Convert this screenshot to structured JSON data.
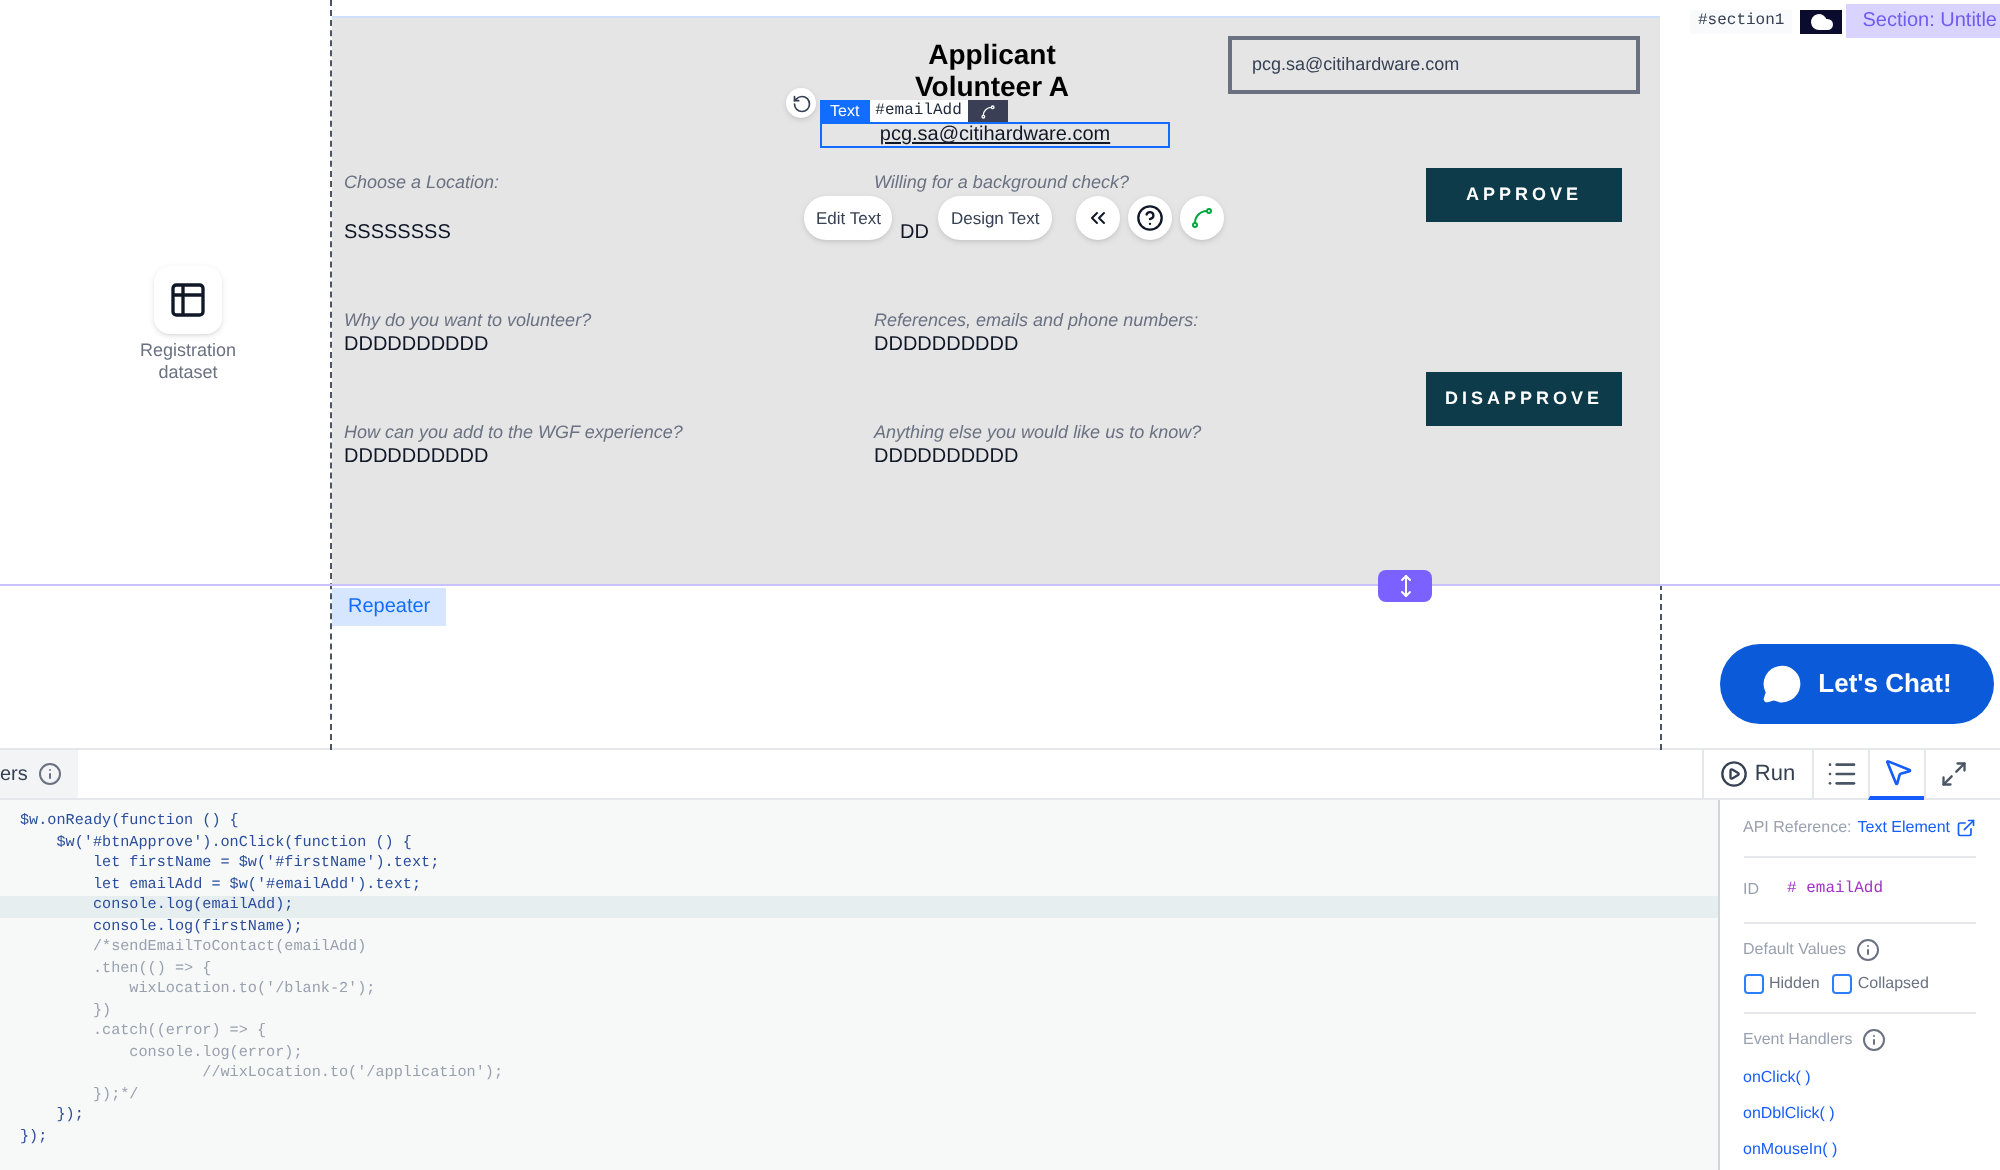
{
  "canvas": {
    "dataset": {
      "label": "Registration dataset"
    },
    "section_tag": {
      "id": "#section1",
      "label": "Section: Untitle"
    },
    "title": "Applicant Volunteer A",
    "email_field": {
      "value": "pcg.sa@citihardware.com"
    },
    "selected_text": {
      "type_label": "Text",
      "id": "#emailAdd",
      "text": "pcg.sa@citihardware.com"
    },
    "fields": [
      {
        "label": "Choose a Location:",
        "value": "SSSSSSSS"
      },
      {
        "label": "Willing for a background check?",
        "value": "DD"
      },
      {
        "label": "Why do you want to volunteer?",
        "value": "DDDDDDDDDD"
      },
      {
        "label": "References, emails and phone numbers:",
        "value": "DDDDDDDDDD"
      },
      {
        "label": "How can you add to the WGF experience?",
        "value": "DDDDDDDDDD"
      },
      {
        "label": "Anything else you would like us to know?",
        "value": "DDDDDDDDDD"
      }
    ],
    "buttons": [
      "APPROVE",
      "DISAPPROVE"
    ],
    "floating_toolbar": [
      "Edit Text",
      "Design Text"
    ],
    "repeater_label": "Repeater",
    "chat_button": "Let's Chat!"
  },
  "code_panel": {
    "tab_label": "ers",
    "toolbar": [
      {
        "kind": "run",
        "label": "Run",
        "selected": false
      },
      {
        "kind": "indent",
        "selected": false
      },
      {
        "kind": "properties",
        "selected": true
      },
      {
        "kind": "expand",
        "selected": false
      }
    ],
    "lines": [
      {
        "kind": "code",
        "text": "$w.onReady(function () {",
        "current": false
      },
      {
        "kind": "code",
        "text": "    $w('#btnApprove').onClick(function () {",
        "current": false
      },
      {
        "kind": "code",
        "text": "        let firstName = $w('#firstName').text;",
        "current": false
      },
      {
        "kind": "code",
        "text": "        let emailAdd = $w('#emailAdd').text;",
        "current": false
      },
      {
        "kind": "code",
        "text": "        console.log(emailAdd);",
        "current": true
      },
      {
        "kind": "code",
        "text": "        console.log(firstName);",
        "current": false
      },
      {
        "kind": "comment",
        "text": "        /*sendEmailToContact(emailAdd)",
        "current": false
      },
      {
        "kind": "comment",
        "text": "        .then(() => {",
        "current": false
      },
      {
        "kind": "comment",
        "text": "            wixLocation.to('/blank-2');",
        "current": false
      },
      {
        "kind": "comment",
        "text": "        })",
        "current": false
      },
      {
        "kind": "comment",
        "text": "        .catch((error) => {",
        "current": false
      },
      {
        "kind": "comment",
        "text": "            console.log(error);",
        "current": false
      },
      {
        "kind": "comment",
        "text": "                    //wixLocation.to('/application');",
        "current": false
      },
      {
        "kind": "comment",
        "text": "        });*/",
        "current": false
      },
      {
        "kind": "code",
        "text": "    });",
        "current": false
      },
      {
        "kind": "code",
        "text": "});",
        "current": false
      }
    ],
    "properties": {
      "api_label": "API Reference:",
      "api_link": "Text Element",
      "id_label": "ID",
      "id_value": "# emailAdd",
      "defaults_label": "Default Values",
      "checkboxes": [
        {
          "label": "Hidden",
          "checked": false
        },
        {
          "label": "Collapsed",
          "checked": false
        }
      ],
      "handlers_label": "Event Handlers",
      "handlers": [
        "onClick( )",
        "onDblClick( )",
        "onMouseIn( )"
      ]
    }
  }
}
